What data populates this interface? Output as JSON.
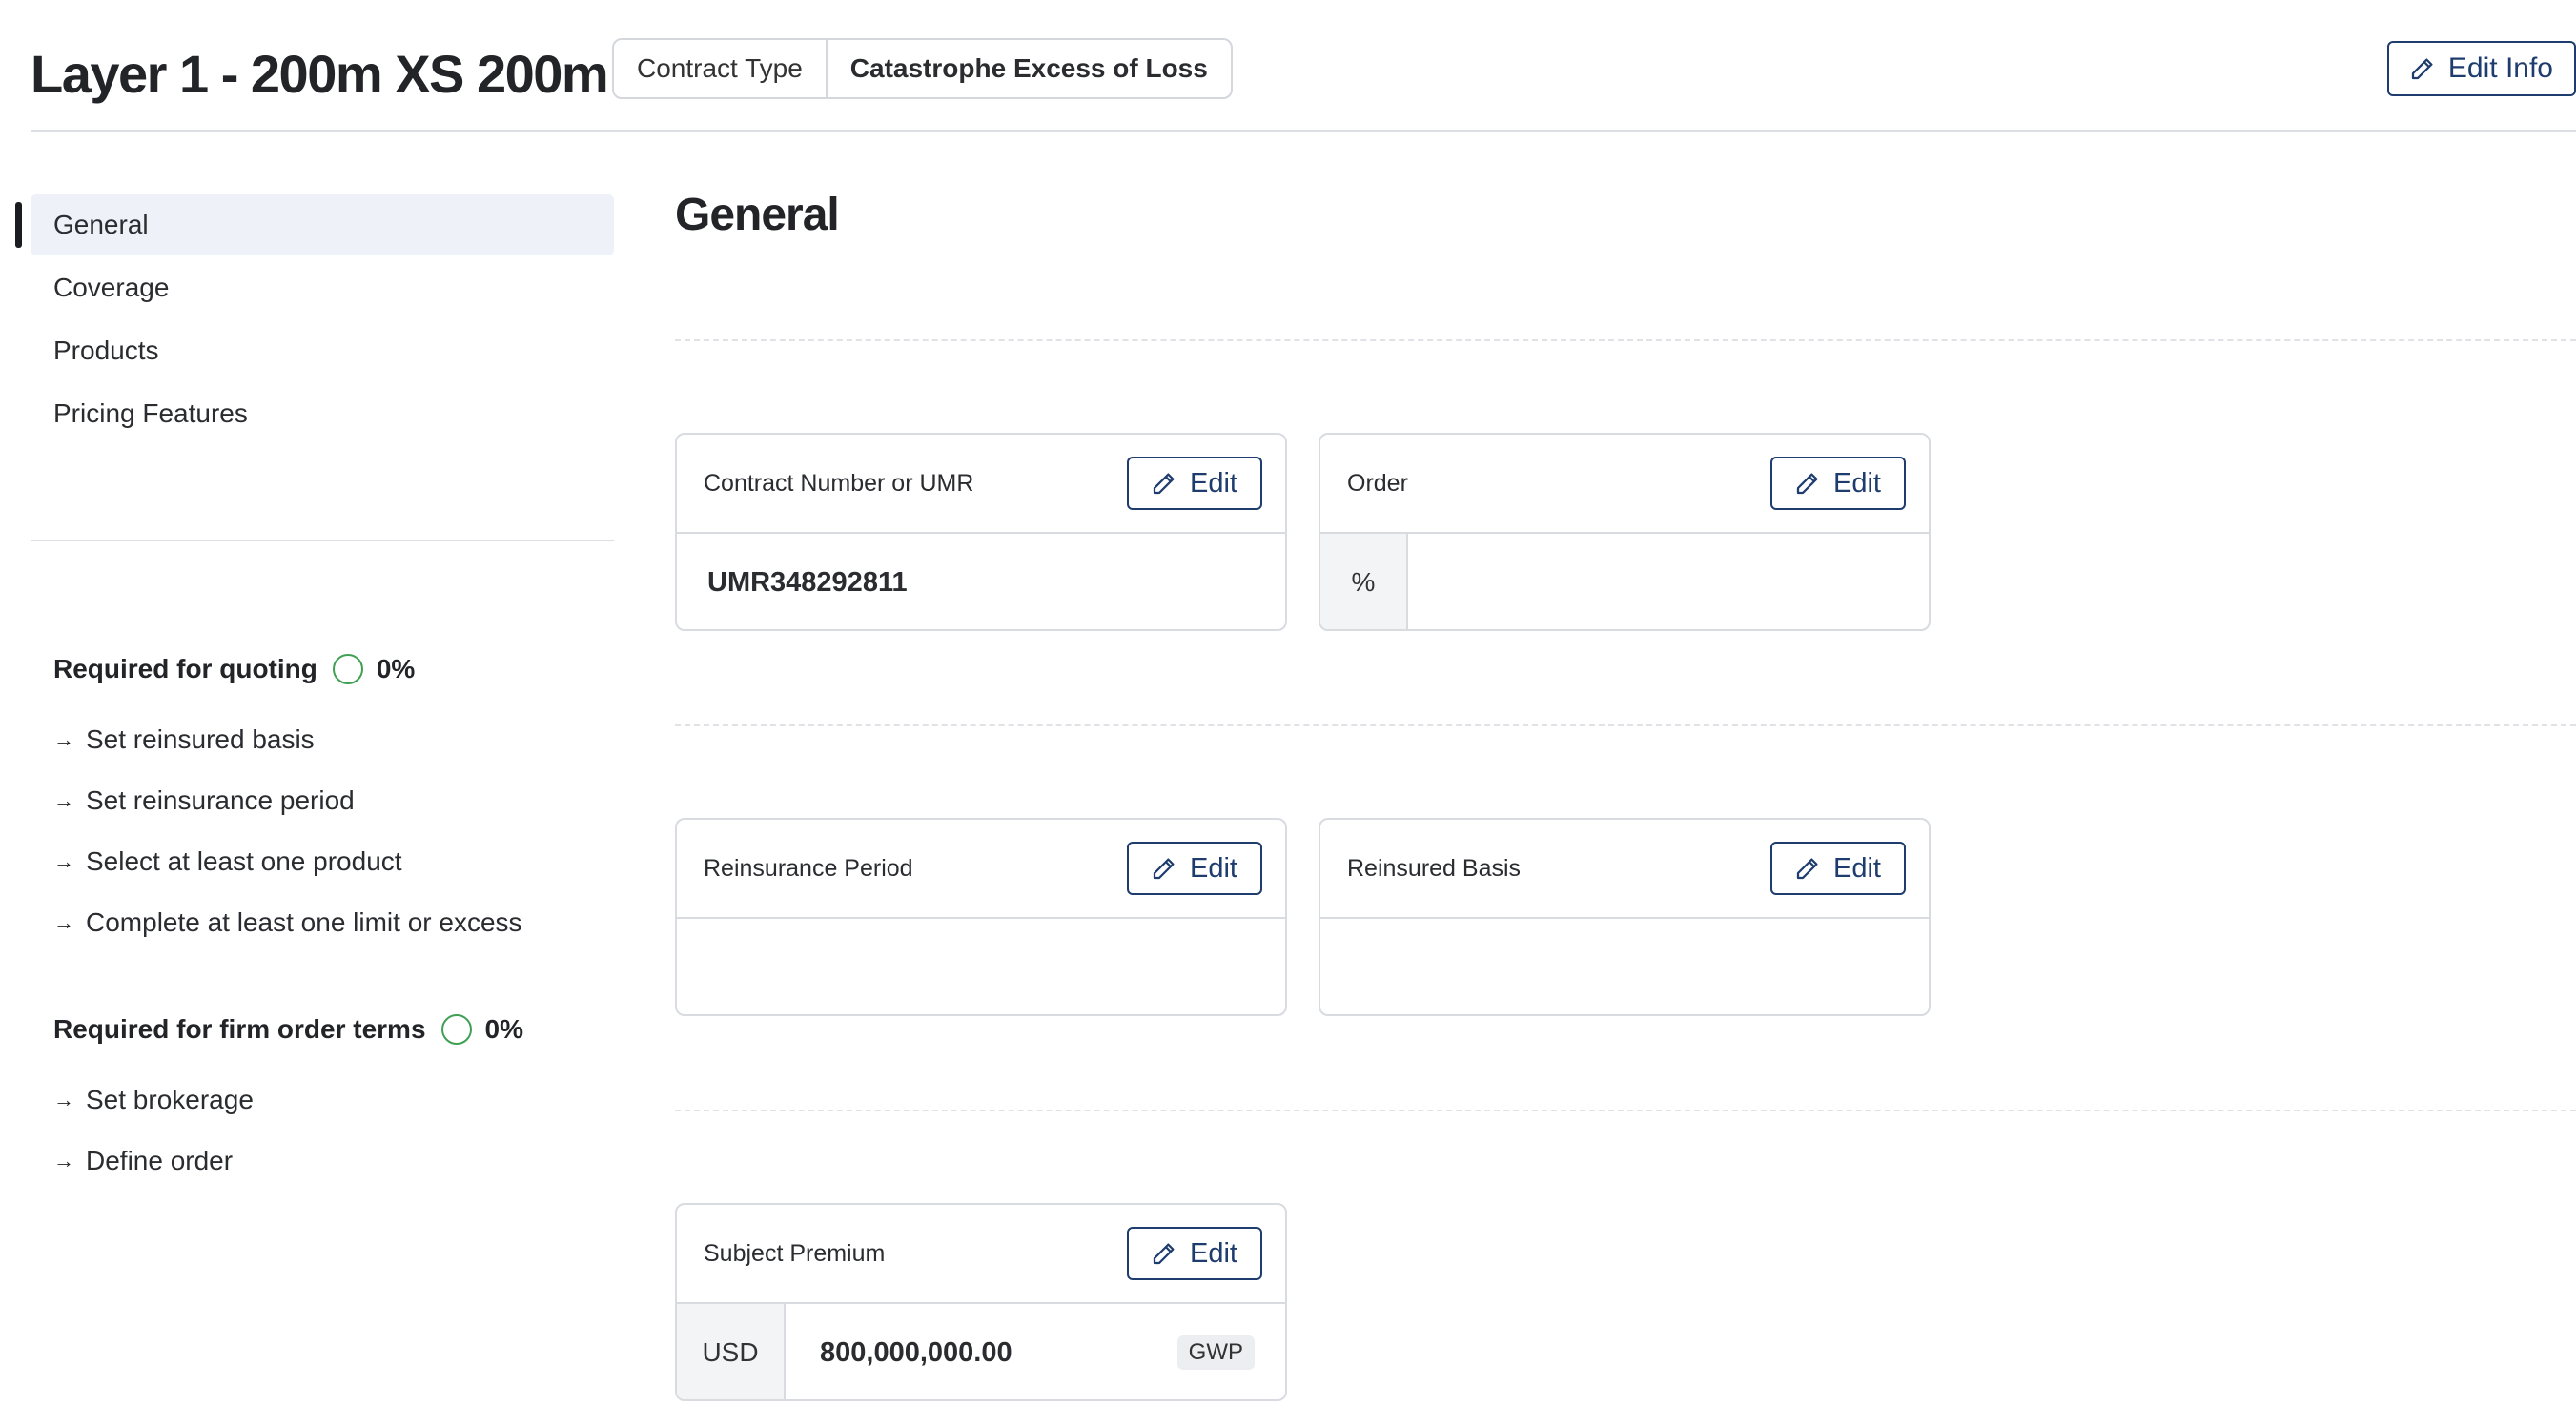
{
  "header": {
    "title": "Layer 1 - 200m XS 200m",
    "contract_type_label": "Contract Type",
    "contract_type_value": "Catastrophe Excess of Loss",
    "edit_info_label": "Edit Info"
  },
  "sidebar": {
    "items": [
      {
        "label": "General",
        "active": true
      },
      {
        "label": "Coverage"
      },
      {
        "label": "Products"
      },
      {
        "label": "Pricing Features"
      }
    ],
    "requirements": [
      {
        "title": "Required for quoting",
        "percent": "0%",
        "items": [
          "Set reinsured basis",
          "Set reinsurance period",
          "Select at least one product",
          "Complete at least one limit or excess"
        ]
      },
      {
        "title": "Required for firm order terms",
        "percent": "0%",
        "items": [
          "Set brokerage",
          "Define order"
        ]
      }
    ]
  },
  "main": {
    "title": "General",
    "edit_label": "Edit",
    "cards": {
      "contract_number": {
        "label": "Contract Number or UMR",
        "value": "UMR348292811"
      },
      "order": {
        "label": "Order",
        "prefix": "%",
        "value": ""
      },
      "reinsurance_period": {
        "label": "Reinsurance Period",
        "value": ""
      },
      "reinsured_basis": {
        "label": "Reinsured Basis",
        "value": ""
      },
      "subject_premium": {
        "label": "Subject Premium",
        "currency": "USD",
        "value": "800,000,000.00",
        "badge": "GWP"
      }
    }
  },
  "colors": {
    "accent": "#1e3c6e",
    "progress_ring": "#3fa054",
    "active_nav_bg": "#eef1f7",
    "border": "#d8dbe0"
  },
  "icons": {
    "edit": "pencil-icon",
    "bullet": "arrow-right-icon",
    "progress": "progress-circle-icon",
    "order_prefix": "percent-icon"
  }
}
